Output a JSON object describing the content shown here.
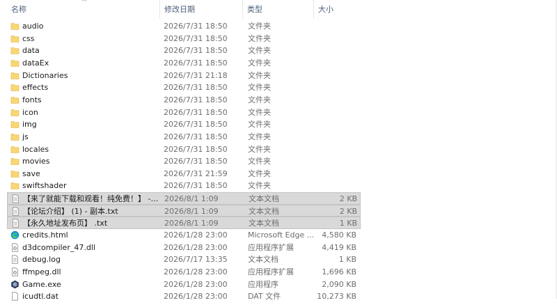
{
  "columns": {
    "name": "名称",
    "modified": "修改日期",
    "type": "类型",
    "size": "大小"
  },
  "files": [
    {
      "name": "audio",
      "modified": "2026/7/31 18:50",
      "type": "文件夹",
      "size": "",
      "icon": "folder-icon",
      "selected": false
    },
    {
      "name": "css",
      "modified": "2026/7/31 18:50",
      "type": "文件夹",
      "size": "",
      "icon": "folder-icon",
      "selected": false
    },
    {
      "name": "data",
      "modified": "2026/7/31 18:50",
      "type": "文件夹",
      "size": "",
      "icon": "folder-icon",
      "selected": false
    },
    {
      "name": "dataEx",
      "modified": "2026/7/31 18:50",
      "type": "文件夹",
      "size": "",
      "icon": "folder-icon",
      "selected": false
    },
    {
      "name": "Dictionaries",
      "modified": "2026/7/31 21:18",
      "type": "文件夹",
      "size": "",
      "icon": "folder-icon",
      "selected": false
    },
    {
      "name": "effects",
      "modified": "2026/7/31 18:50",
      "type": "文件夹",
      "size": "",
      "icon": "folder-icon",
      "selected": false
    },
    {
      "name": "fonts",
      "modified": "2026/7/31 18:50",
      "type": "文件夹",
      "size": "",
      "icon": "folder-icon",
      "selected": false
    },
    {
      "name": "icon",
      "modified": "2026/7/31 18:50",
      "type": "文件夹",
      "size": "",
      "icon": "folder-icon",
      "selected": false
    },
    {
      "name": "img",
      "modified": "2026/7/31 18:50",
      "type": "文件夹",
      "size": "",
      "icon": "folder-icon",
      "selected": false
    },
    {
      "name": "js",
      "modified": "2026/7/31 18:50",
      "type": "文件夹",
      "size": "",
      "icon": "folder-icon",
      "selected": false
    },
    {
      "name": "locales",
      "modified": "2026/7/31 18:50",
      "type": "文件夹",
      "size": "",
      "icon": "folder-icon",
      "selected": false
    },
    {
      "name": "movies",
      "modified": "2026/7/31 18:50",
      "type": "文件夹",
      "size": "",
      "icon": "folder-icon",
      "selected": false
    },
    {
      "name": "save",
      "modified": "2026/7/31 21:59",
      "type": "文件夹",
      "size": "",
      "icon": "folder-icon",
      "selected": false
    },
    {
      "name": "swiftshader",
      "modified": "2026/7/31 18:50",
      "type": "文件夹",
      "size": "",
      "icon": "folder-icon",
      "selected": false
    },
    {
      "name": "【来了就能下载和观看！纯免费！】 - 副...",
      "modified": "2026/8/1 1:09",
      "type": "文本文档",
      "size": "2 KB",
      "icon": "text-file-icon",
      "selected": true
    },
    {
      "name": "【论坛介绍】 (1) - 副本.txt",
      "modified": "2026/8/1 1:09",
      "type": "文本文档",
      "size": "2 KB",
      "icon": "text-file-icon",
      "selected": true
    },
    {
      "name": "【永久地址发布页】 .txt",
      "modified": "2026/8/1 1:09",
      "type": "文本文档",
      "size": "1 KB",
      "icon": "text-file-icon",
      "selected": true
    },
    {
      "name": "credits.html",
      "modified": "2026/1/28 23:00",
      "type": "Microsoft Edge ...",
      "size": "4,580 KB",
      "icon": "edge-html-icon",
      "selected": false
    },
    {
      "name": "d3dcompiler_47.dll",
      "modified": "2026/1/28 23:00",
      "type": "应用程序扩展",
      "size": "4,419 KB",
      "icon": "dll-file-icon",
      "selected": false
    },
    {
      "name": "debug.log",
      "modified": "2026/7/17 13:35",
      "type": "文本文档",
      "size": "1 KB",
      "icon": "text-file-icon",
      "selected": false
    },
    {
      "name": "ffmpeg.dll",
      "modified": "2026/1/28 23:00",
      "type": "应用程序扩展",
      "size": "1,696 KB",
      "icon": "dll-file-icon",
      "selected": false
    },
    {
      "name": "Game.exe",
      "modified": "2026/1/28 23:00",
      "type": "应用程序",
      "size": "2,090 KB",
      "icon": "app-exe-icon",
      "selected": false
    },
    {
      "name": "icudtl.dat",
      "modified": "2026/1/28 23:00",
      "type": "DAT 文件",
      "size": "10,273 KB",
      "icon": "dat-file-icon",
      "selected": false
    }
  ],
  "colors": {
    "folder": "#f8d775",
    "selection": "#d9d9d9",
    "header_text": "#4c607a"
  }
}
